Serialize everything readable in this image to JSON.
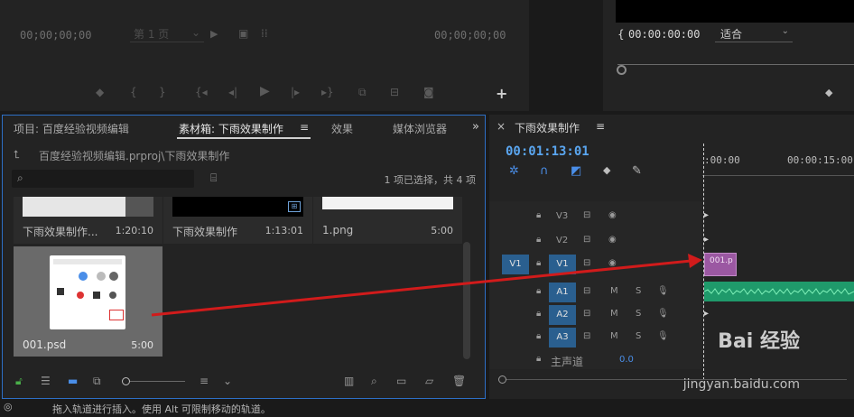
{
  "source_monitor": {
    "timecode_left": "00;00;00;00",
    "timecode_right": "00;00;00;00",
    "page_select": "第 1 页"
  },
  "program_monitor": {
    "timecode": "00:00:00:00",
    "fit_select": "适合"
  },
  "bin_panel": {
    "tabs": [
      {
        "label": "项目: 百度经验视频编辑"
      },
      {
        "label": "素材箱: 下雨效果制作"
      },
      {
        "label": "效果"
      },
      {
        "label": "媒体浏览器"
      }
    ],
    "path": "百度经验视频编辑.prproj\\下雨效果制作",
    "selection_count": "1 项已选择，共 4 项",
    "items": [
      {
        "name": "下雨效果制作...",
        "duration": "1:20:10"
      },
      {
        "name": "下雨效果制作",
        "duration": "1:13:01"
      },
      {
        "name": "1.png",
        "duration": "5:00"
      },
      {
        "name": "001.psd",
        "duration": "5:00"
      }
    ]
  },
  "timeline": {
    "title": "下雨效果制作",
    "timecode": "00:01:13:01",
    "ruler": [
      ":00:00",
      "00:00:15:00"
    ],
    "tracks": {
      "video": [
        {
          "name": "V3"
        },
        {
          "name": "V2"
        },
        {
          "name": "V1",
          "source": "V1"
        }
      ],
      "audio": [
        {
          "name": "A1",
          "m": "M",
          "s": "S"
        },
        {
          "name": "A2",
          "m": "M",
          "s": "S"
        },
        {
          "name": "A3",
          "m": "M",
          "s": "S"
        }
      ],
      "master": {
        "label": "主声道",
        "value": "0.0"
      }
    },
    "clip_v1": "001.p"
  },
  "status_bar": {
    "text": "拖入轨道进行插入。使用 Alt 可限制移动的轨道。"
  },
  "watermark": {
    "text": "Bai 经验",
    "url": "jingyan.baidu.com"
  },
  "colors": {
    "accent_blue": "#2d6fc6",
    "timecode_blue": "#5aa6f0",
    "clip_purple": "#9b58a2",
    "clip_green": "#1f9a6b",
    "arrow_red": "#d11b1b"
  }
}
